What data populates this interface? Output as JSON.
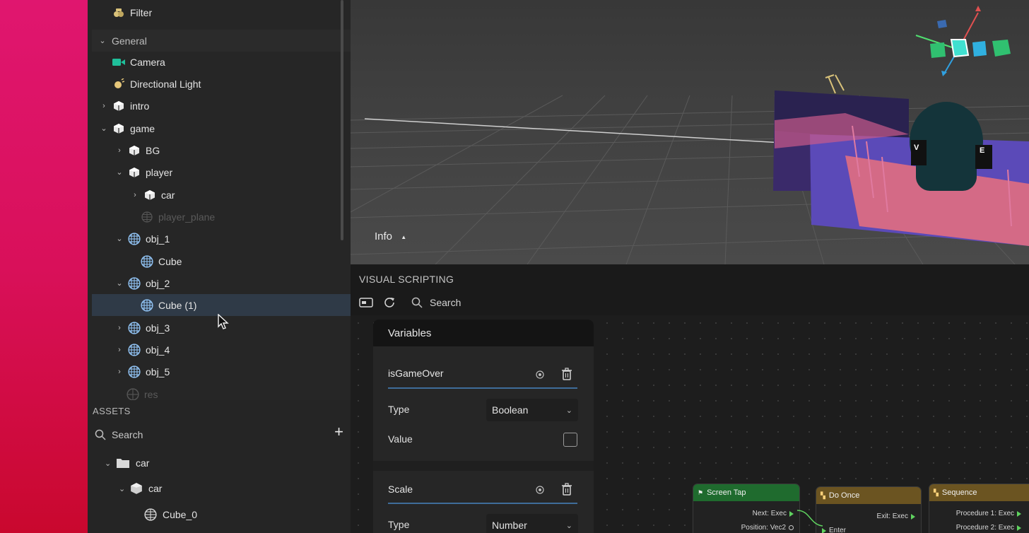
{
  "colors": {
    "accent": "#3f6d9a",
    "screen_tap": "#1f6b2e",
    "do_once": "#6b5421",
    "sequence": "#6b5421",
    "exec_port": "#5fd35f"
  },
  "hierarchy": {
    "filter_label": "Filter",
    "items": [
      {
        "label": "General",
        "icon": "none",
        "chevron": "down",
        "checked": true
      },
      {
        "label": "Camera",
        "icon": "camera-icon",
        "chevron": "",
        "checked": true
      },
      {
        "label": "Directional Light",
        "icon": "light-icon",
        "chevron": "",
        "checked": true
      },
      {
        "label": "intro",
        "icon": "object-icon",
        "chevron": "right",
        "checked": true
      },
      {
        "label": "game",
        "icon": "object-icon",
        "chevron": "down",
        "checked": true
      },
      {
        "label": "BG",
        "icon": "object-icon",
        "chevron": "right",
        "checked": true
      },
      {
        "label": "player",
        "icon": "object-icon",
        "chevron": "down",
        "checked": true
      },
      {
        "label": "car",
        "icon": "object-icon",
        "chevron": "right",
        "checked": true
      },
      {
        "label": "player_plane",
        "icon": "mesh-icon",
        "chevron": "",
        "checked": false
      },
      {
        "label": "obj_1",
        "icon": "mesh-icon",
        "chevron": "down",
        "checked": true
      },
      {
        "label": "Cube",
        "icon": "mesh-icon",
        "chevron": "",
        "checked": true
      },
      {
        "label": "obj_2",
        "icon": "mesh-icon",
        "chevron": "down",
        "checked": true
      },
      {
        "label": "Cube (1)",
        "icon": "mesh-icon",
        "chevron": "",
        "checked": true
      },
      {
        "label": "obj_3",
        "icon": "mesh-icon",
        "chevron": "right",
        "checked": true
      },
      {
        "label": "obj_4",
        "icon": "mesh-icon",
        "chevron": "right",
        "checked": true
      },
      {
        "label": "obj_5",
        "icon": "mesh-icon",
        "chevron": "right",
        "checked": true
      },
      {
        "label": "res",
        "icon": "mesh-icon",
        "chevron": "",
        "checked": false
      }
    ]
  },
  "assets": {
    "title": "ASSETS",
    "search_placeholder": "Search",
    "add_label": "+",
    "tree": [
      {
        "label": "car",
        "icon": "folder-icon"
      },
      {
        "label": "car",
        "icon": "package-icon"
      },
      {
        "label": "Cube_0",
        "icon": "mesh-icon"
      }
    ]
  },
  "viewport": {
    "info_label": "Info",
    "info_arrow": "▲"
  },
  "visual_scripting": {
    "title": "VISUAL SCRIPTING",
    "search_placeholder": "Search",
    "variables": {
      "header": "Variables",
      "items": [
        {
          "name": "isGameOver",
          "type_label": "Type",
          "type_value": "Boolean",
          "value_label": "Value",
          "value_checked": false
        },
        {
          "name": "Scale",
          "type_label": "Type",
          "type_value": "Number"
        }
      ]
    },
    "nodes": [
      {
        "title": "Screen Tap",
        "ports": [
          "Next: Exec",
          "Position: Vec2"
        ]
      },
      {
        "title": "Do Once",
        "ports": [
          "Exit: Exec",
          "Enter"
        ]
      },
      {
        "title": "Sequence",
        "ports": [
          "Procedure 1: Exec",
          "Procedure 2: Exec"
        ]
      }
    ]
  },
  "viewport_overlay_letters": [
    "V",
    "E"
  ]
}
